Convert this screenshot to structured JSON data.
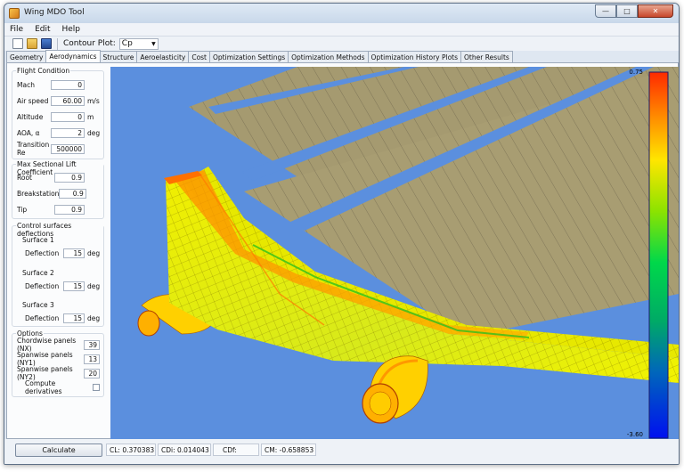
{
  "window": {
    "title": "Wing MDO Tool"
  },
  "menu": [
    "File",
    "Edit",
    "Help"
  ],
  "toolbar": {
    "contour_label": "Contour Plot:",
    "contour_value": "Cp"
  },
  "tabs": [
    "Geometry",
    "Aerodynamics",
    "Structure",
    "Aeroelasticity",
    "Cost",
    "Optimization Settings",
    "Optimization Methods",
    "Optimization History Plots",
    "Other Results"
  ],
  "active_tab": "Aerodynamics",
  "flight_condition": {
    "title": "Flight Condition",
    "mach_label": "Mach",
    "mach_value": "0",
    "airspeed_label": "Air speed",
    "airspeed_value": "60.00",
    "airspeed_unit": "m/s",
    "altitude_label": "Altitude",
    "altitude_value": "0",
    "altitude_unit": "m",
    "aoa_label": "AOA, α",
    "aoa_value": "2",
    "aoa_unit": "deg",
    "re_label": "Transition Re",
    "re_value": "500000"
  },
  "max_lift": {
    "title": "Max Sectional Lift Coefficient",
    "root_label": "Root",
    "root_value": "0.9",
    "break_label": "Breakstation",
    "break_value": "0.9",
    "tip_label": "Tip",
    "tip_value": "0.9"
  },
  "control_surfaces": {
    "title": "Control surfaces deflections",
    "s1_label": "Surface 1",
    "s2_label": "Surface 2",
    "s3_label": "Surface 3",
    "deflection_label": "Deflection",
    "deg_unit": "deg",
    "s1_value": "15",
    "s2_value": "15",
    "s3_value": "15"
  },
  "options": {
    "title": "Options",
    "nx_label": "Chordwise panels (NX)",
    "nx_value": "39",
    "ny1_label": "Spanwise panels (NY1)",
    "ny1_value": "13",
    "ny2_label": "Spanwise panels (NY2)",
    "ny2_value": "20",
    "derivatives_label": "Compute derivatives",
    "derivatives_checked": false
  },
  "colorbar": {
    "max_label": "0.75",
    "min_label": "-3.60"
  },
  "status": {
    "calculate_label": "Calculate",
    "cl": "CL: 0.370383",
    "cdi": "CDi: 0.014043",
    "cdf": "CDf:",
    "cm": "CM: -0.658853"
  },
  "colors": {
    "viewport_bg": "#5b8fde",
    "flap_surface": "#a59a70"
  }
}
